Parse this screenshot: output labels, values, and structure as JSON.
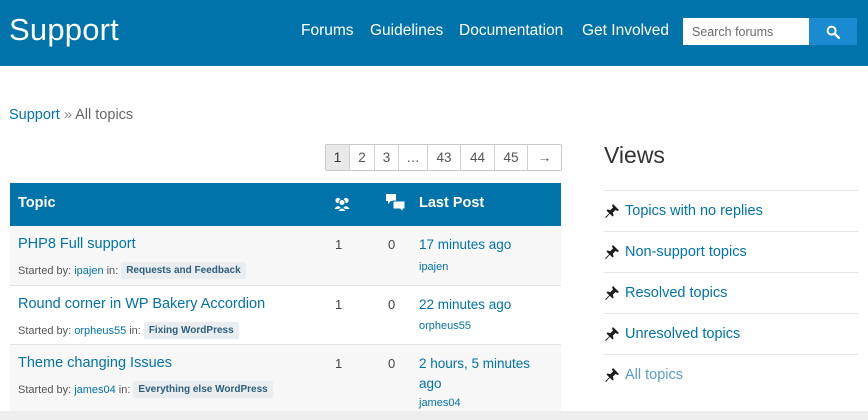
{
  "header": {
    "brand": "Support",
    "nav": [
      {
        "label": "Forums"
      },
      {
        "label": "Guidelines"
      },
      {
        "label": "Documentation"
      },
      {
        "label": "Get Involved"
      }
    ],
    "search_placeholder": "Search forums",
    "search_icon": "search-icon",
    "bg_color": "#0073aa"
  },
  "breadcrumb": {
    "root": "Support",
    "separator": "»",
    "current": "All topics"
  },
  "pagination": {
    "pages": [
      "1",
      "2",
      "3",
      "…",
      "43",
      "44",
      "45",
      "→"
    ],
    "current": "1"
  },
  "table": {
    "header": {
      "topic": "Topic",
      "voices_icon": "users-icon",
      "replies_icon": "speech-bubbles-icon",
      "last_post": "Last Post"
    },
    "rows": [
      {
        "title": "PHP8 Full support",
        "started_by_label": "Started by:",
        "author": "ipajen",
        "in_label": "in:",
        "forum": "Requests and Feedback",
        "voices": "1",
        "replies": "0",
        "freshness": "17 minutes ago",
        "last_poster": "ipajen"
      },
      {
        "title": "Round corner in WP Bakery Accordion",
        "started_by_label": "Started by:",
        "author": "orpheus55",
        "in_label": "in:",
        "forum": "Fixing WordPress",
        "voices": "1",
        "replies": "0",
        "freshness": "22 minutes ago",
        "last_poster": "orpheus55"
      },
      {
        "title": "Theme changing Issues",
        "started_by_label": "Started by:",
        "author": "james04",
        "in_label": "in:",
        "forum": "Everything else WordPress",
        "voices": "1",
        "replies": "0",
        "freshness": "2 hours, 5 minutes ago",
        "last_poster": "james04"
      }
    ]
  },
  "views": {
    "title": "Views",
    "items": [
      {
        "label": "Topics with no replies",
        "icon": "pin-icon"
      },
      {
        "label": "Non-support topics",
        "icon": "pin-icon"
      },
      {
        "label": "Resolved topics",
        "icon": "pin-icon"
      },
      {
        "label": "Unresolved topics",
        "icon": "pin-icon"
      },
      {
        "label": "All topics",
        "icon": "pin-icon"
      }
    ]
  }
}
